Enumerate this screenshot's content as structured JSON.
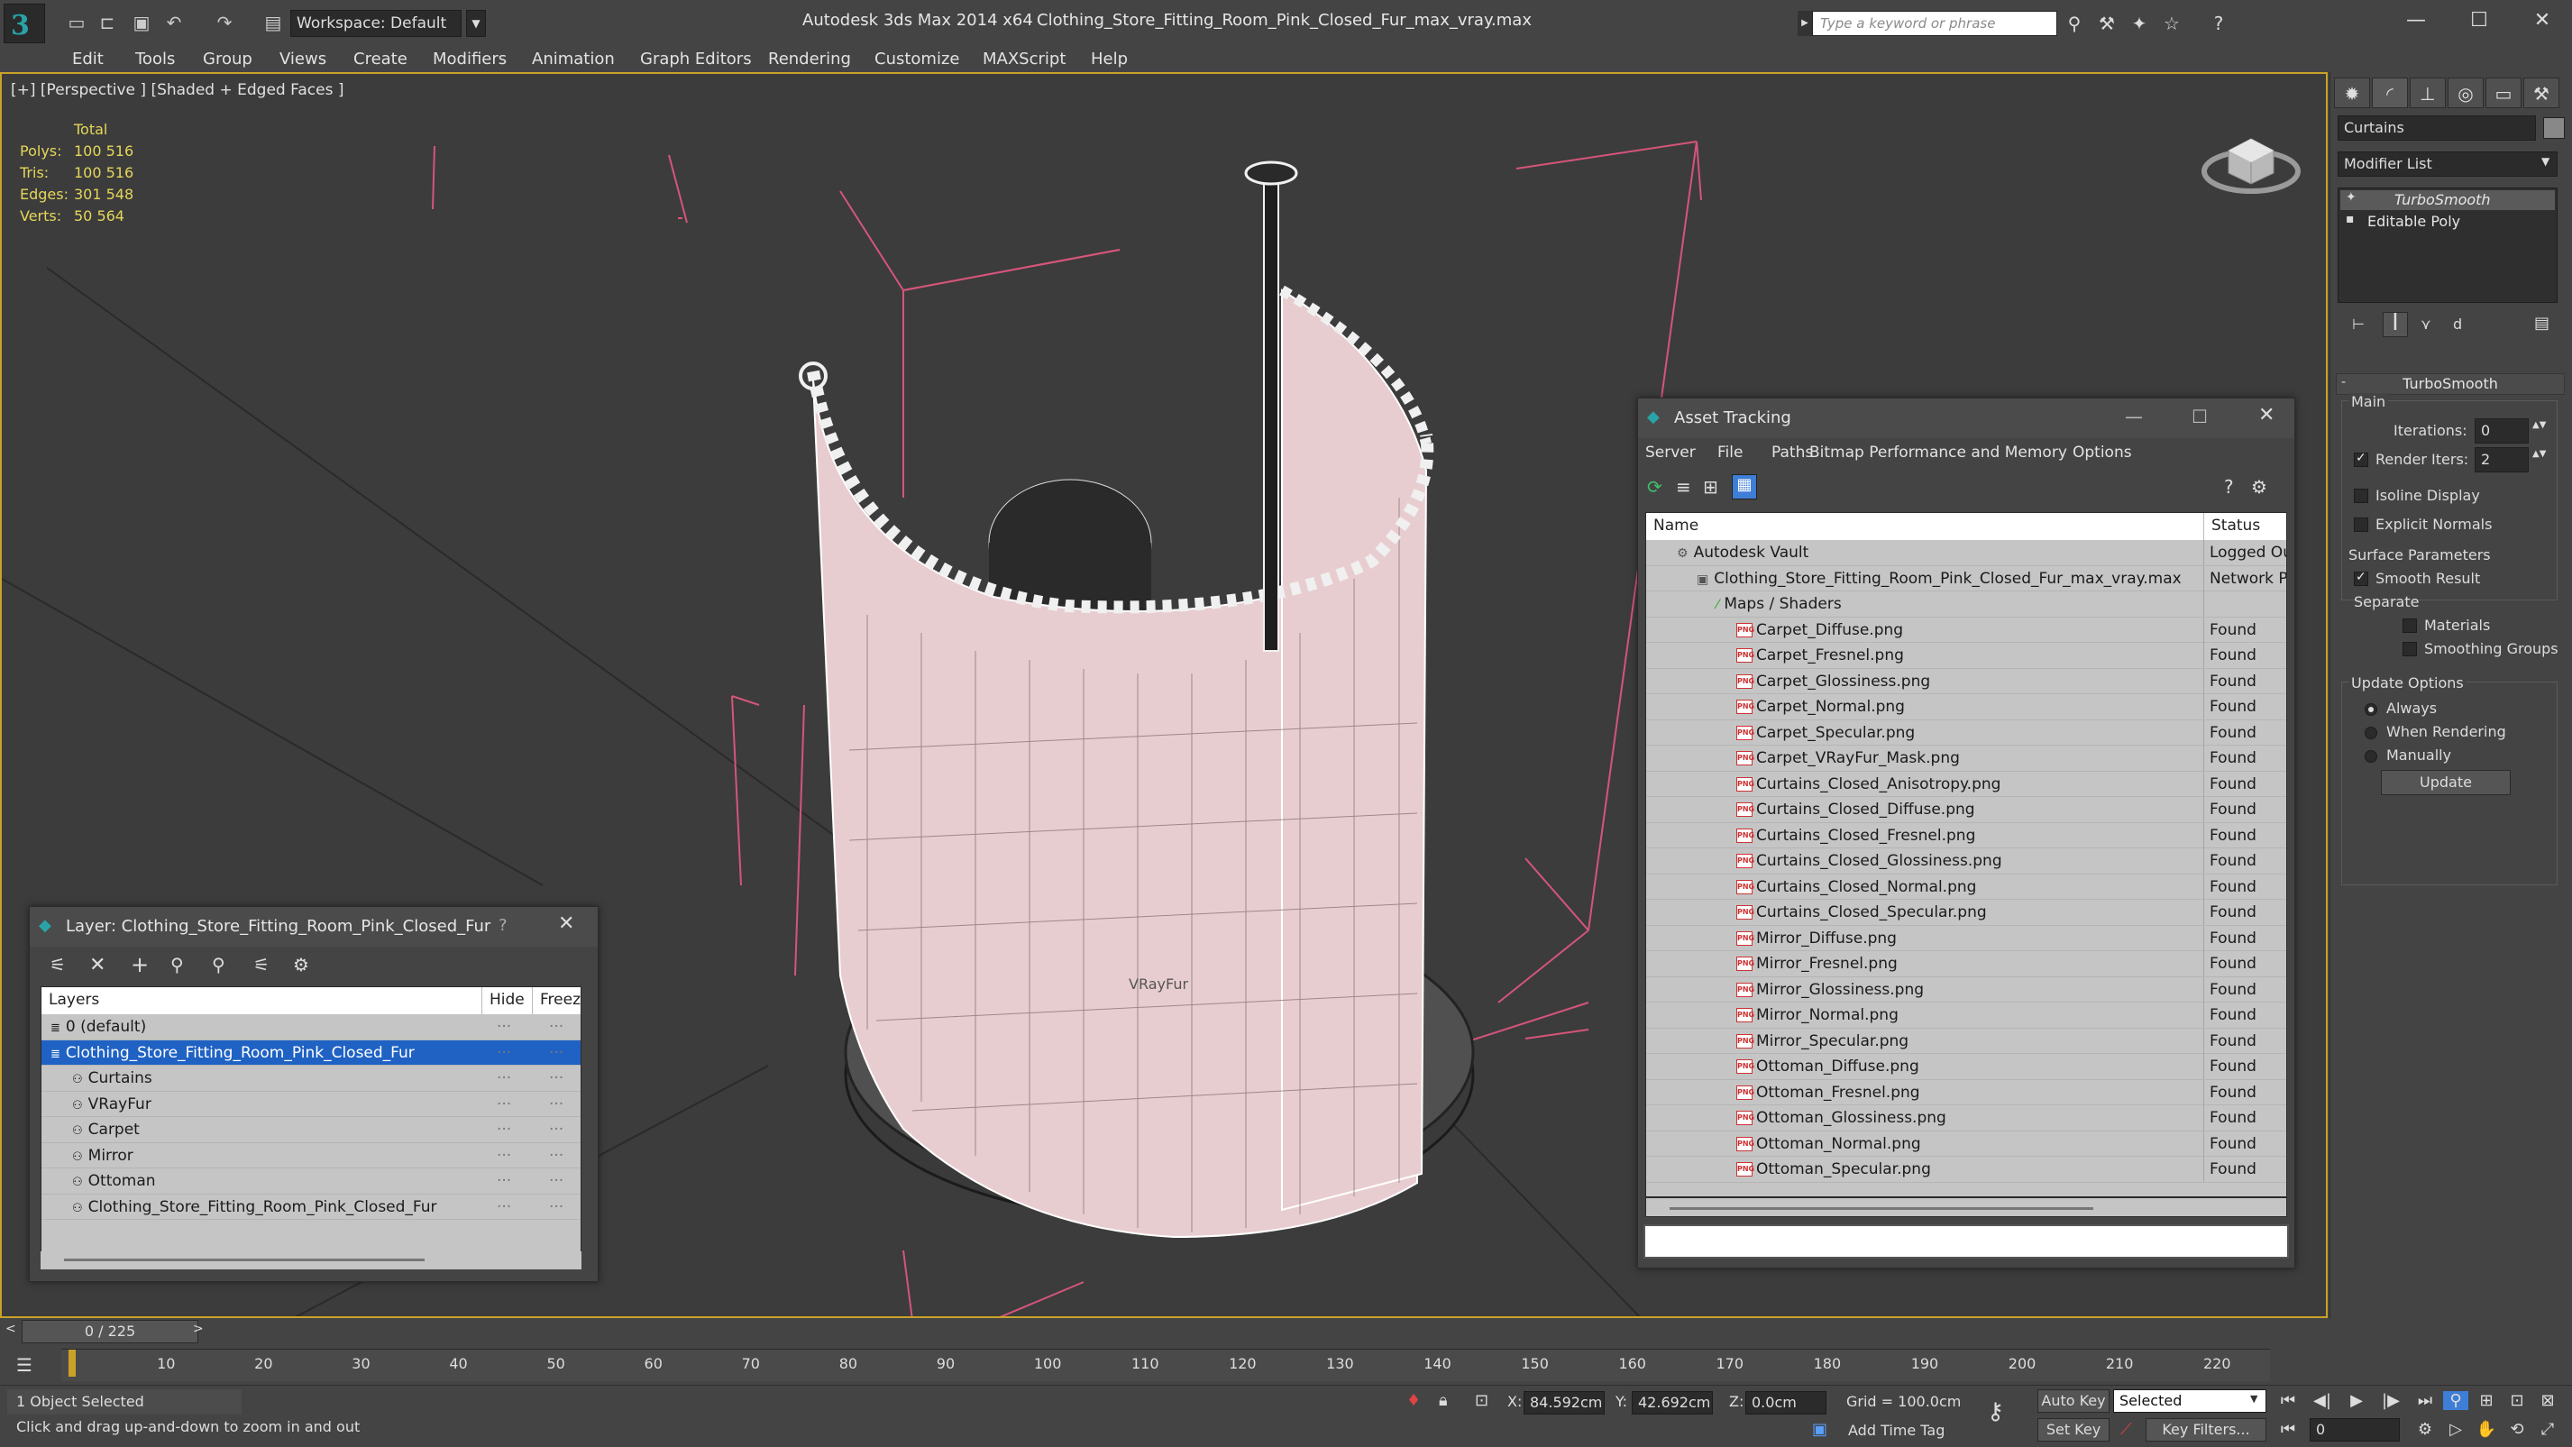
{
  "titlebar": {
    "workspace": "Workspace: Default",
    "app_title": "Autodesk 3ds Max  2014 x64",
    "file_title": "Clothing_Store_Fitting_Room_Pink_Closed_Fur_max_vray.max",
    "search_placeholder": "Type a keyword or phrase"
  },
  "menu": [
    "Edit",
    "Tools",
    "Group",
    "Views",
    "Create",
    "Modifiers",
    "Animation",
    "Graph Editors",
    "Rendering",
    "Customize",
    "MAXScript",
    "Help"
  ],
  "viewport": {
    "label": "[+] [Perspective ] [Shaded + Edged Faces ]",
    "stats": {
      "header": "Total",
      "rows": [
        {
          "k": "Polys:",
          "v": "100 516"
        },
        {
          "k": "Tris:",
          "v": "100 516"
        },
        {
          "k": "Edges:",
          "v": "301 548"
        },
        {
          "k": "Verts:",
          "v": "50 564"
        }
      ]
    },
    "mesh_label": "VRayFur"
  },
  "command_panel": {
    "object_name": "Curtains",
    "modifier_list": "Modifier List",
    "stack": [
      "TurboSmooth",
      "Editable Poly"
    ],
    "turbosmooth": {
      "title": "TurboSmooth",
      "main": "Main",
      "iterations_label": "Iterations:",
      "iterations": "0",
      "render_iters_label": "Render Iters:",
      "render_iters": "2",
      "isoline": "Isoline Display",
      "explicit": "Explicit Normals",
      "surface_params": "Surface Parameters",
      "smooth_result": "Smooth Result",
      "separate": "Separate",
      "materials": "Materials",
      "smoothing_groups": "Smoothing Groups",
      "update_options": "Update Options",
      "always": "Always",
      "when_rendering": "When Rendering",
      "manually": "Manually",
      "update_btn": "Update"
    }
  },
  "asset_tracking": {
    "title": "Asset Tracking",
    "menu": [
      "Server",
      "File",
      "Paths",
      "Bitmap Performance and Memory",
      "Options"
    ],
    "col_name": "Name",
    "col_status": "Status",
    "rows": [
      {
        "name": "Autodesk Vault",
        "status": "Logged Out",
        "indent": 1
      },
      {
        "name": "Clothing_Store_Fitting_Room_Pink_Closed_Fur_max_vray.max",
        "status": "Network Pa",
        "indent": 2
      },
      {
        "name": "Maps / Shaders",
        "status": "",
        "indent": 3
      },
      {
        "name": "Carpet_Diffuse.png",
        "status": "Found",
        "indent": 4
      },
      {
        "name": "Carpet_Fresnel.png",
        "status": "Found",
        "indent": 4
      },
      {
        "name": "Carpet_Glossiness.png",
        "status": "Found",
        "indent": 4
      },
      {
        "name": "Carpet_Normal.png",
        "status": "Found",
        "indent": 4
      },
      {
        "name": "Carpet_Specular.png",
        "status": "Found",
        "indent": 4
      },
      {
        "name": "Carpet_VRayFur_Mask.png",
        "status": "Found",
        "indent": 4
      },
      {
        "name": "Curtains_Closed_Anisotropy.png",
        "status": "Found",
        "indent": 4
      },
      {
        "name": "Curtains_Closed_Diffuse.png",
        "status": "Found",
        "indent": 4
      },
      {
        "name": "Curtains_Closed_Fresnel.png",
        "status": "Found",
        "indent": 4
      },
      {
        "name": "Curtains_Closed_Glossiness.png",
        "status": "Found",
        "indent": 4
      },
      {
        "name": "Curtains_Closed_Normal.png",
        "status": "Found",
        "indent": 4
      },
      {
        "name": "Curtains_Closed_Specular.png",
        "status": "Found",
        "indent": 4
      },
      {
        "name": "Mirror_Diffuse.png",
        "status": "Found",
        "indent": 4
      },
      {
        "name": "Mirror_Fresnel.png",
        "status": "Found",
        "indent": 4
      },
      {
        "name": "Mirror_Glossiness.png",
        "status": "Found",
        "indent": 4
      },
      {
        "name": "Mirror_Normal.png",
        "status": "Found",
        "indent": 4
      },
      {
        "name": "Mirror_Specular.png",
        "status": "Found",
        "indent": 4
      },
      {
        "name": "Ottoman_Diffuse.png",
        "status": "Found",
        "indent": 4
      },
      {
        "name": "Ottoman_Fresnel.png",
        "status": "Found",
        "indent": 4
      },
      {
        "name": "Ottoman_Glossiness.png",
        "status": "Found",
        "indent": 4
      },
      {
        "name": "Ottoman_Normal.png",
        "status": "Found",
        "indent": 4
      },
      {
        "name": "Ottoman_Specular.png",
        "status": "Found",
        "indent": 4
      }
    ]
  },
  "layer_explorer": {
    "title": "Layer: Clothing_Store_Fitting_Room_Pink_Closed_Fur",
    "help": "?",
    "col_layers": "Layers",
    "col_hide": "Hide",
    "col_freeze": "Freeze",
    "rows": [
      {
        "name": "0 (default)",
        "indent": 0,
        "selected": false
      },
      {
        "name": "Clothing_Store_Fitting_Room_Pink_Closed_Fur",
        "indent": 0,
        "selected": true
      },
      {
        "name": "Curtains",
        "indent": 1,
        "selected": false
      },
      {
        "name": "VRayFur",
        "indent": 1,
        "selected": false
      },
      {
        "name": "Carpet",
        "indent": 1,
        "selected": false
      },
      {
        "name": "Mirror",
        "indent": 1,
        "selected": false
      },
      {
        "name": "Ottoman",
        "indent": 1,
        "selected": false
      },
      {
        "name": "Clothing_Store_Fitting_Room_Pink_Closed_Fur",
        "indent": 1,
        "selected": false
      }
    ]
  },
  "timeline": {
    "frame": "0 / 225",
    "ticks": [
      "10",
      "20",
      "30",
      "40",
      "50",
      "60",
      "70",
      "80",
      "90",
      "100",
      "110",
      "120",
      "130",
      "140",
      "150",
      "160",
      "170",
      "180",
      "190",
      "200",
      "210",
      "220"
    ]
  },
  "status": {
    "selection": "1 Object Selected",
    "prompt": "Click and drag up-and-down to zoom in and out",
    "x_label": "X:",
    "x": "84.592cm",
    "y_label": "Y:",
    "y": "42.692cm",
    "z_label": "Z:",
    "z": "0.0cm",
    "grid": "Grid = 100.0cm",
    "add_time_tag": "Add Time Tag",
    "auto_key": "Auto Key",
    "set_key": "Set Key",
    "selected": "Selected",
    "key_filters": "Key Filters...",
    "frame_field": "0"
  },
  "colors": {
    "accent": "#c9a227",
    "selection": "#1f62c4",
    "curtain": "#e8cdd0",
    "stats": "#e5d65a"
  }
}
